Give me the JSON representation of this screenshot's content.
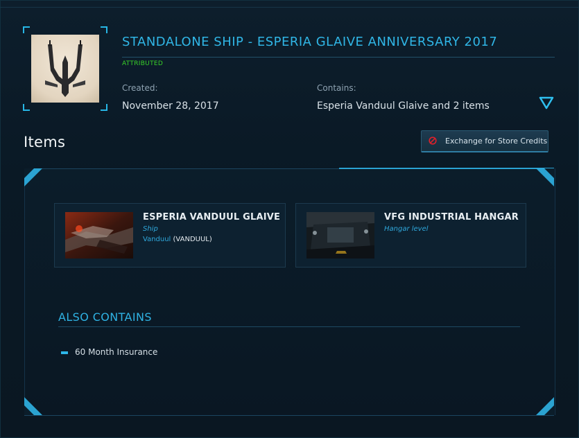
{
  "pledge": {
    "title": "STANDALONE SHIP - ESPERIA GLAIVE ANNIVERSARY 2017",
    "status": "ATTRIBUTED",
    "created_label": "Created:",
    "created_value": "November 28, 2017",
    "contains_label": "Contains:",
    "contains_value": "Esperia Vanduul Glaive and 2 items",
    "toggle_icon": "chevron-down-triangle-icon"
  },
  "items_section": {
    "heading": "Items",
    "exchange_button": {
      "label": "Exchange for Store Credits",
      "icon": "no-entry-icon"
    },
    "cards": [
      {
        "title": "ESPERIA VANDUUL GLAIVE",
        "type": "Ship",
        "manufacturer": "Vanduul",
        "manufacturer_code": "(VANDUUL)"
      },
      {
        "title": "VFG INDUSTRIAL HANGAR",
        "type": "Hangar level"
      }
    ],
    "also_contains": {
      "heading": "ALSO CONTAINS",
      "items": [
        "60 Month Insurance"
      ]
    }
  },
  "colors": {
    "accent": "#2fb3e4",
    "status_green": "#39d128",
    "background": "#0a1824",
    "alert_red": "#e0202a"
  }
}
